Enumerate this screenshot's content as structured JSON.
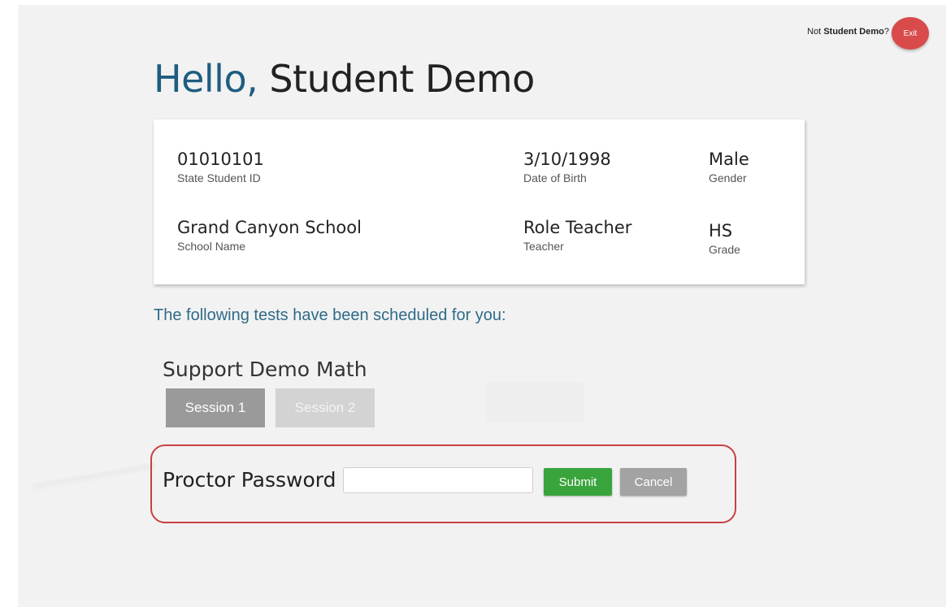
{
  "header": {
    "not_prefix": "Not",
    "user_name": "Student Demo",
    "not_suffix": "?",
    "exit_label": "Exit"
  },
  "greeting": {
    "hello": "Hello,",
    "name": "Student Demo"
  },
  "student_info": {
    "state_student_id": {
      "value": "01010101",
      "label": "State Student ID"
    },
    "date_of_birth": {
      "value": "3/10/1998",
      "label": "Date of Birth"
    },
    "gender": {
      "value": "Male",
      "label": "Gender"
    },
    "school_name": {
      "value": "Grand Canyon School",
      "label": "School Name"
    },
    "teacher": {
      "value": "Role Teacher",
      "label": "Teacher"
    },
    "grade": {
      "value": "HS",
      "label": "Grade"
    }
  },
  "scheduled_text": "The following tests have been scheduled for you:",
  "test": {
    "name": "Support Demo Math",
    "sessions": [
      "Session 1",
      "Session 2"
    ]
  },
  "proctor": {
    "label": "Proctor Password",
    "input_value": "",
    "input_placeholder": "",
    "submit_label": "Submit",
    "cancel_label": "Cancel"
  },
  "colors": {
    "hello_blue": "#1d5d80",
    "exit_red": "#d94a4a",
    "submit_green": "#3aa43c",
    "highlight_red": "#c94040"
  }
}
